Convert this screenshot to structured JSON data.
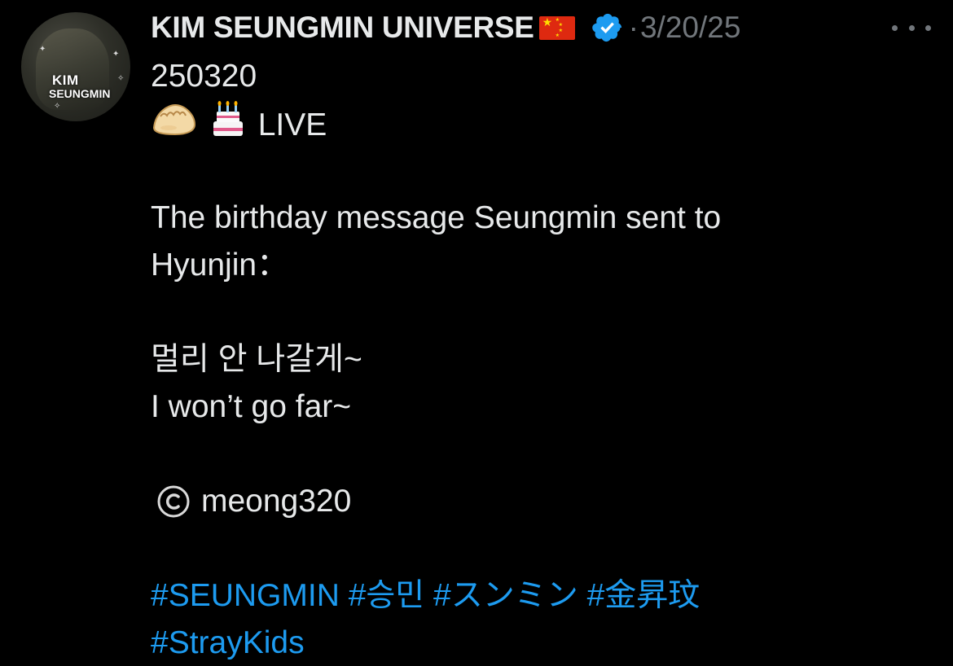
{
  "author": {
    "display_name": "KIM SEUNGMIN UNIVERSE",
    "flag_icon": "china-flag-icon",
    "verified_icon": "verified-badge-icon",
    "separator": "·",
    "timestamp": "3/20/25",
    "avatar_text_top": "KIM",
    "avatar_text_bottom": "SEUNGMIN"
  },
  "menu": {
    "icon": "more-horizontal-icon"
  },
  "tweet": {
    "line1": "250320",
    "line2_emojis": [
      "dumpling-emoji",
      "birthday-cake-emoji"
    ],
    "line2_text": "LIVE",
    "line3": "The birthday message Seungmin sent to",
    "line4": "Hyunjin：",
    "line5": "멀리 안 나갈게~",
    "line6": "I won’t go far~",
    "credit_icon": "copyright-icon",
    "credit_text": "meong320",
    "hashtags_line1": [
      "#SEUNGMIN",
      "#승민",
      "#スンミン",
      "#金昇玟"
    ],
    "hashtags_line2": [
      "#StrayKids"
    ]
  },
  "colors": {
    "background": "#000000",
    "text": "#e7e9ea",
    "muted": "#71767b",
    "link": "#1d9bf0",
    "verified": "#1d9bf0"
  }
}
